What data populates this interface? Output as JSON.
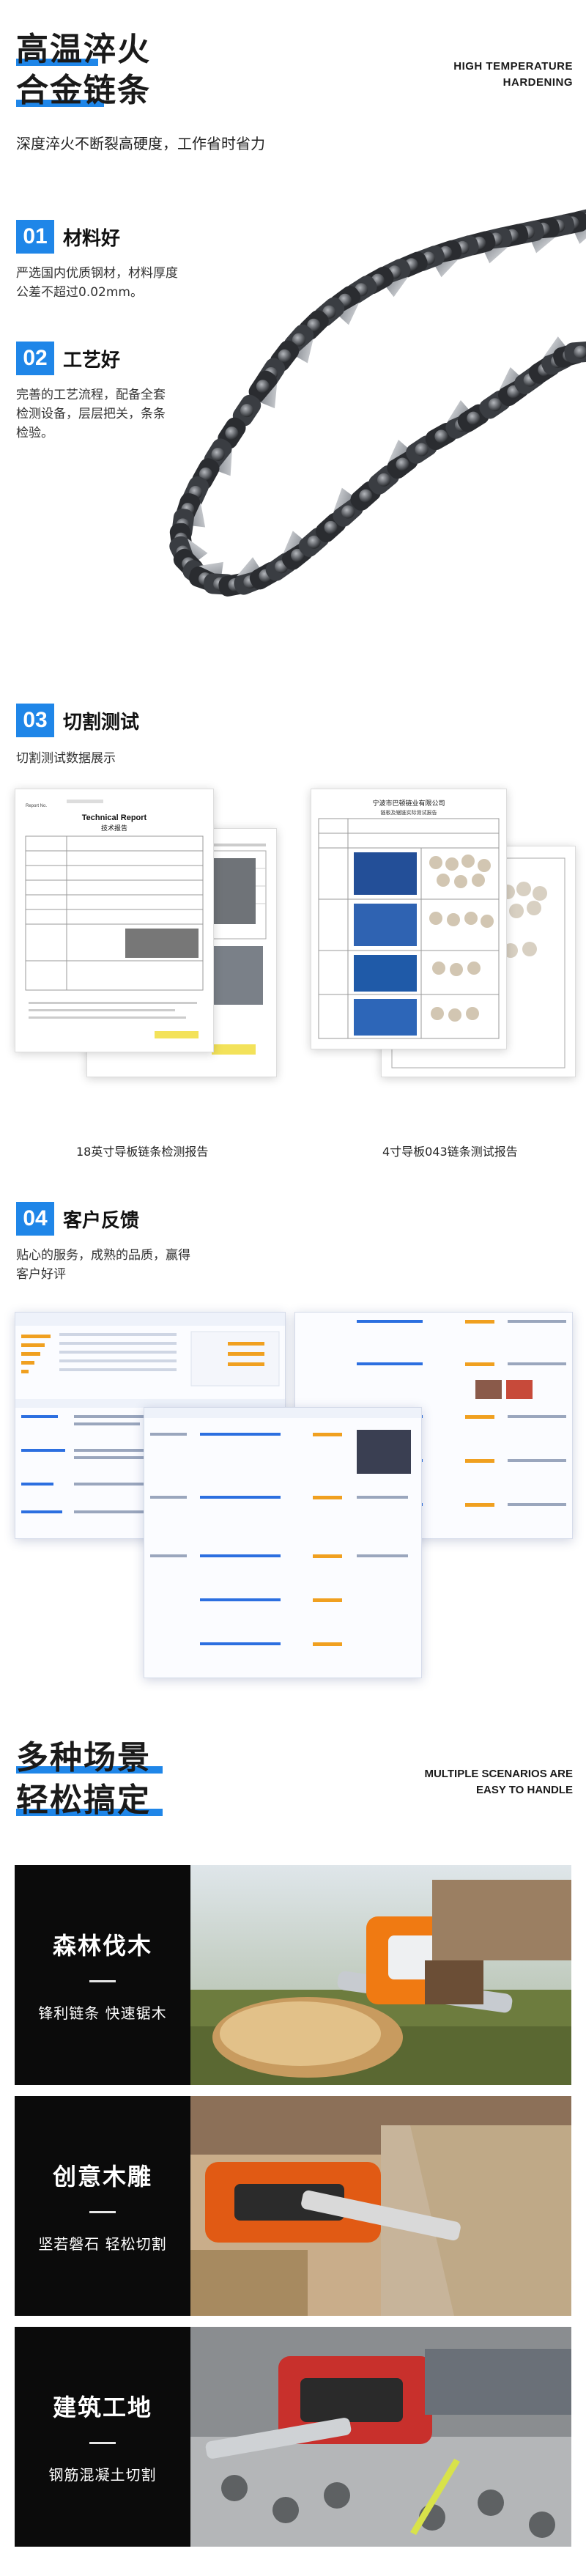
{
  "hero": {
    "title_line1": "高温淬火",
    "title_line2": "合金链条",
    "en_line1": "HIGH TEMPERATURE",
    "en_line2": "HARDENING",
    "subtitle": "深度淬火不断裂高硬度，工作省时省力"
  },
  "features": [
    {
      "num": "01",
      "title": "材料好",
      "desc": "严选国内优质钢材，材料厚度公差不超过0.02mm。"
    },
    {
      "num": "02",
      "title": "工艺好",
      "desc": "完善的工艺流程，配备全套检测设备，层层把关，条条检验。"
    },
    {
      "num": "03",
      "title": "切割测试",
      "desc": "切割测试数据展示"
    },
    {
      "num": "04",
      "title": "客户反馈",
      "desc": "贴心的服务，成熟的品质，赢得客户好评"
    }
  ],
  "reports": {
    "left_caption": "18英寸导板链条检测报告",
    "right_caption": "4寸导板043链条测试报告",
    "doc_title_en": "Technical Report",
    "doc_title_cn": "技术报告",
    "doc2_title": "宁波市巴顿链业有限公司",
    "doc2_subtitle": "链板及锯链实际测试报告"
  },
  "scenarios": {
    "title_line1": "多种场景",
    "title_line2": "轻松搞定",
    "en_line1": "MULTIPLE SCENARIOS ARE",
    "en_line2": "EASY TO HANDLE",
    "items": [
      {
        "name": "森林伐木",
        "tag": "锋利链条 快速锯木"
      },
      {
        "name": "创意木雕",
        "tag": "坚若磐石 轻松切割"
      },
      {
        "name": "建筑工地",
        "tag": "钢筋混凝土切割"
      }
    ]
  },
  "colors": {
    "accent": "#1f86e8",
    "scene_bg": "#0b0b0b"
  }
}
